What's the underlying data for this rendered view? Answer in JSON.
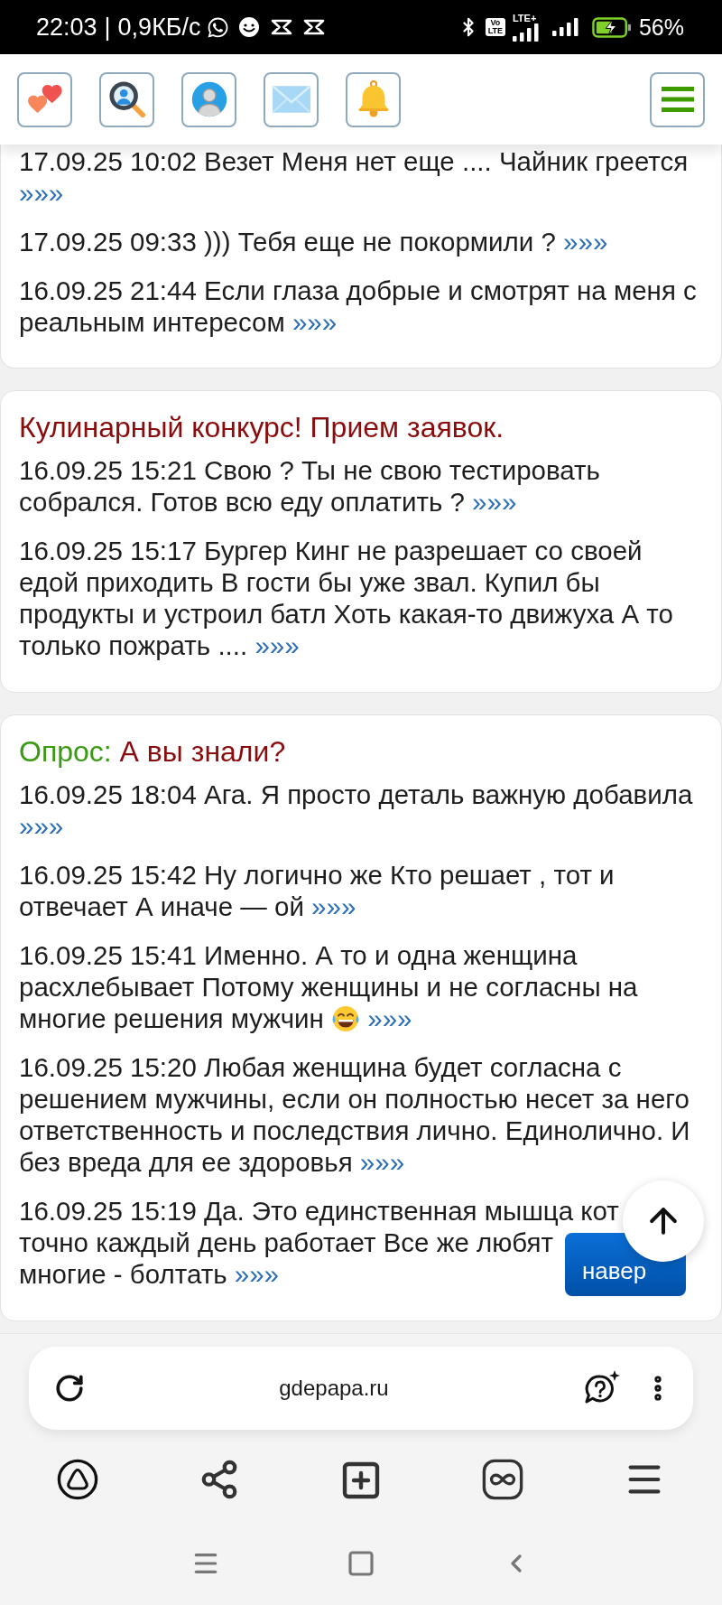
{
  "status_bar": {
    "time": "22:03",
    "separator": "|",
    "network_speed": "0,9КБ/с",
    "volte": "Vo LTE",
    "network_type": "LTE+",
    "battery": "56%"
  },
  "cards": [
    {
      "entries": [
        {
          "time": "17.09.25 10:02",
          "text": "Везет Меня нет еще .... Чайник греется",
          "more": "»»»"
        },
        {
          "time": "17.09.25 09:33",
          "text": "))) Тебя еще не покормили ?",
          "more": "»»»"
        },
        {
          "time": "16.09.25 21:44",
          "text": "Если глаза добрые и смотрят на меня с реальным интересом",
          "more": "»»»"
        }
      ]
    },
    {
      "title": "Кулинарный конкурс! Прием заявок.",
      "entries": [
        {
          "time": "16.09.25 15:21",
          "text": "Свою ? Ты не свою тестировать собрался. Готов всю еду оплатить ?",
          "more": "»»»"
        },
        {
          "time": "16.09.25 15:17",
          "text": "Бургер Кинг не разрешает со своей едой приходить В гости бы уже звал. Купил бы продукты и устроил батл Хоть какая-то движуха А то только пожрать ....",
          "more": "»»»"
        }
      ]
    },
    {
      "title_prefix": "Опрос:",
      "title": "А вы знали?",
      "entries": [
        {
          "time": "16.09.25 18:04",
          "text": "Ага. Я просто деталь важную добавила",
          "more": "»»»"
        },
        {
          "time": "16.09.25 15:42",
          "text": "Ну логично же Кто решает , тот и отвечает А иначе — ой",
          "more": "»»»"
        },
        {
          "time": "16.09.25 15:41",
          "text": "Именно. А то и одна женщина расхлебывает Потому женщины и не согласны на многие решения мужчин",
          "emoji": true,
          "more": "»»»"
        },
        {
          "time": "16.09.25 15:20",
          "text": "Любая женщина будет согласна с решением мужчины, если он полностью несет за него ответственность и последствия лично. Единолично. И без вреда для ее здоровья",
          "more": "»»»"
        },
        {
          "time": "16.09.25 15:19",
          "lines": [
            "Да. Это единственная мышца кот",
            "точно каждый день работает Все же любят",
            "многие - болтать"
          ],
          "more": "»»»"
        }
      ]
    }
  ],
  "scroll_top": {
    "label": "навер"
  },
  "browser": {
    "url": "gdepapa.ru"
  }
}
